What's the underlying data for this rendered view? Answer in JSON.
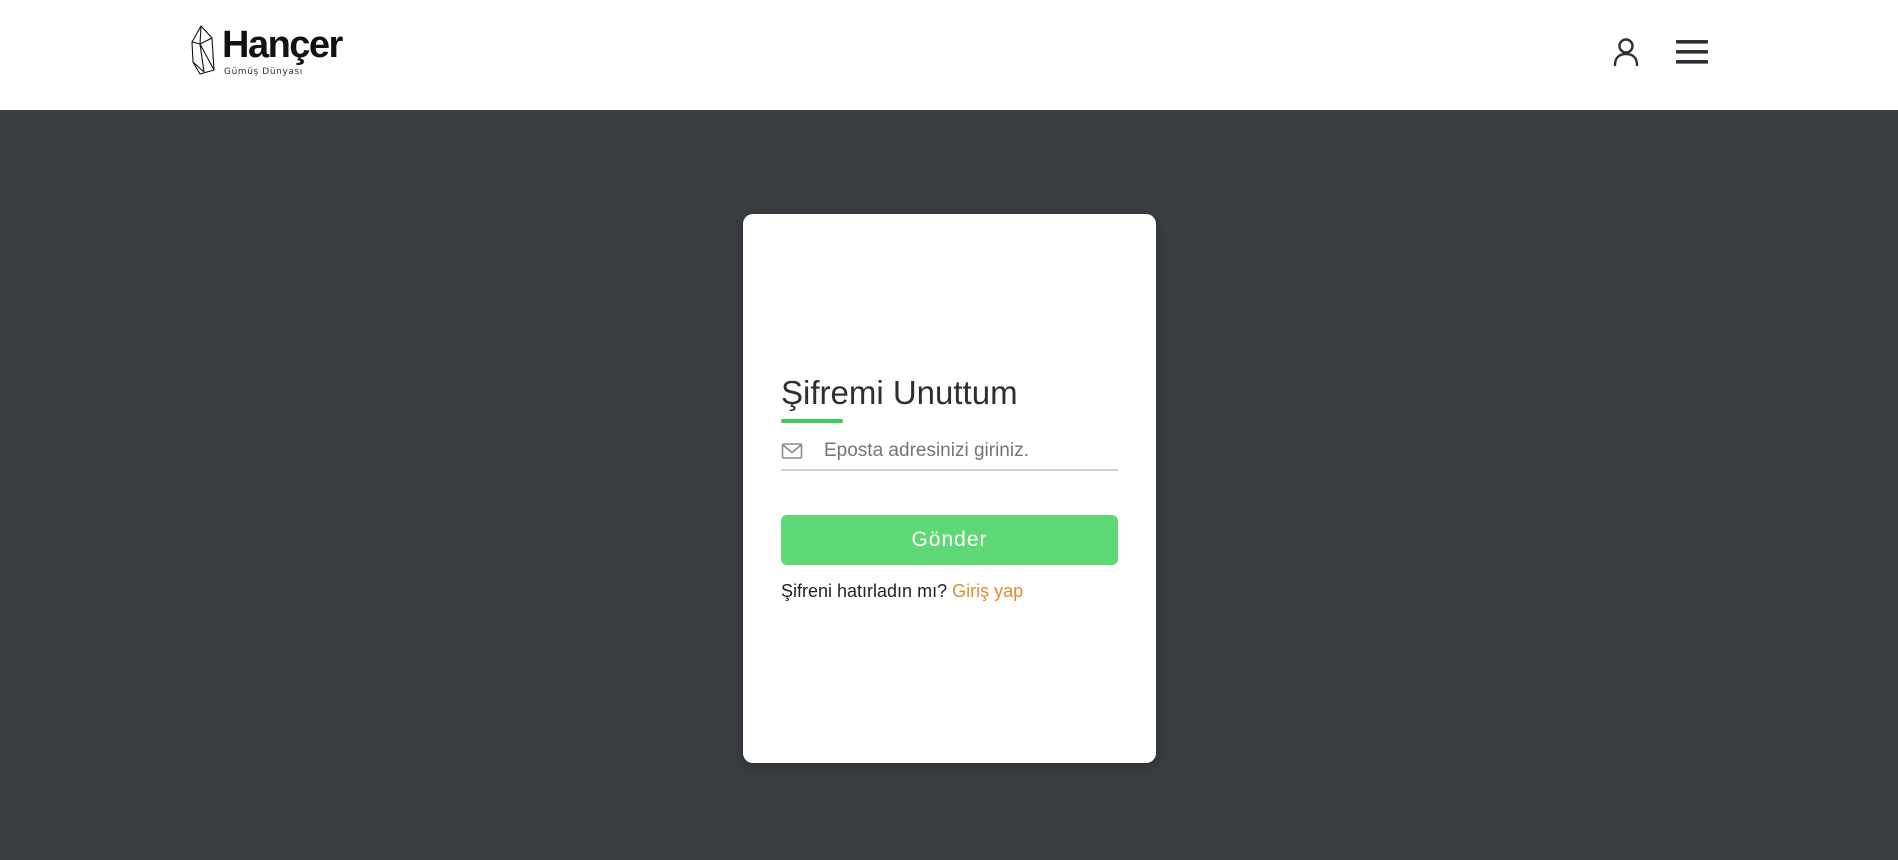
{
  "header": {
    "logo": {
      "brand": "Hançer",
      "tagline": "Gümüş Dünyası"
    },
    "icons": [
      "user-icon",
      "hamburger-menu-icon"
    ]
  },
  "form": {
    "title": "Şifremi Unuttum",
    "email_placeholder": "Eposta adresinizi giriniz.",
    "email_value": "",
    "submit_label": "Gönder",
    "remember_text": "Şifreni hatırladın mı?",
    "login_link_label": "Giriş yap"
  },
  "colors": {
    "background": "#3a3e42",
    "accent_green": "#5fd975",
    "underline_green": "#3ccf4e",
    "link_orange": "#e58a2e"
  }
}
